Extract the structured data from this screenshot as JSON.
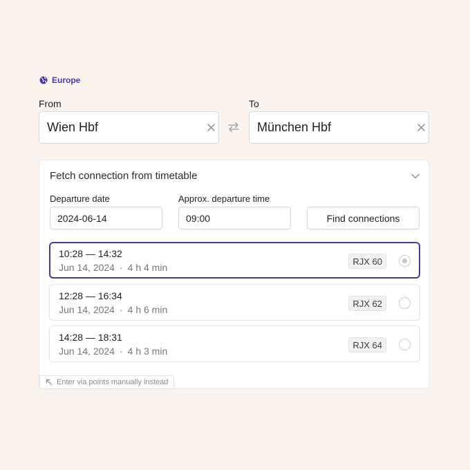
{
  "region": {
    "label": "Europe",
    "icon": "globe-icon"
  },
  "from": {
    "label": "From",
    "value": "Wien Hbf"
  },
  "to": {
    "label": "To",
    "value": "München Hbf"
  },
  "timetable": {
    "title": "Fetch connection from timetable",
    "departure_date": {
      "label": "Departure date",
      "value": "2024-06-14"
    },
    "departure_time": {
      "label": "Approx. departure time",
      "value": "09:00"
    },
    "find_label": "Find connections",
    "connections": [
      {
        "times": "10:28 — 14:32",
        "date": "Jun 14, 2024",
        "duration": "4 h 4 min",
        "train": "RJX 60",
        "selected": true
      },
      {
        "times": "12:28 — 16:34",
        "date": "Jun 14, 2024",
        "duration": "4 h 6 min",
        "train": "RJX 62",
        "selected": false
      },
      {
        "times": "14:28 — 18:31",
        "date": "Jun 14, 2024",
        "duration": "4 h 3 min",
        "train": "RJX 64",
        "selected": false
      }
    ],
    "manual_link": "Enter via points manually instead"
  },
  "colors": {
    "accent": "#4a3a8a",
    "background": "#fbf4ee"
  }
}
